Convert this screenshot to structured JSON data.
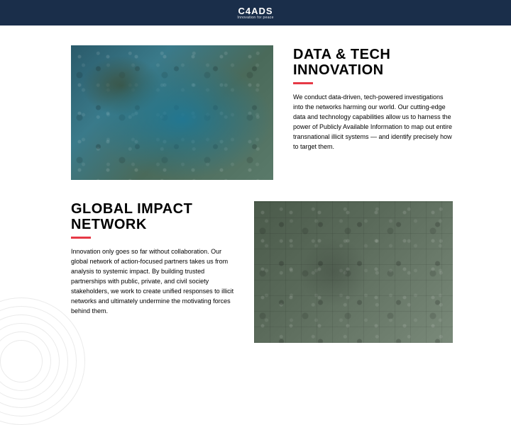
{
  "header": {
    "logo_main": "C4ADS",
    "logo_sub": "Innovation for peace"
  },
  "sections": [
    {
      "heading": "DATA & TECH INNOVATION",
      "body": "We conduct data-driven, tech-powered investigations into the networks harming our world. Our cutting-edge data and technology capabilities allow us to harness the power of Publicly Available Information to map out entire transnational illicit systems — and identify precisely how to target them.",
      "image_alt": "satellite-coastal-city"
    },
    {
      "heading": "GLOBAL IMPACT NETWORK",
      "body": "Innovation only goes so far without collaboration. Our global network of action-focused partners takes us from analysis to systemic impact. By building trusted partnerships with public, private, and civil society stakeholders, we work to create unified responses to illicit networks and ultimately undermine the motivating forces behind them.",
      "image_alt": "satellite-suburban-grid"
    }
  ],
  "colors": {
    "accent": "#e63946",
    "topbar": "#1a2e4a"
  }
}
